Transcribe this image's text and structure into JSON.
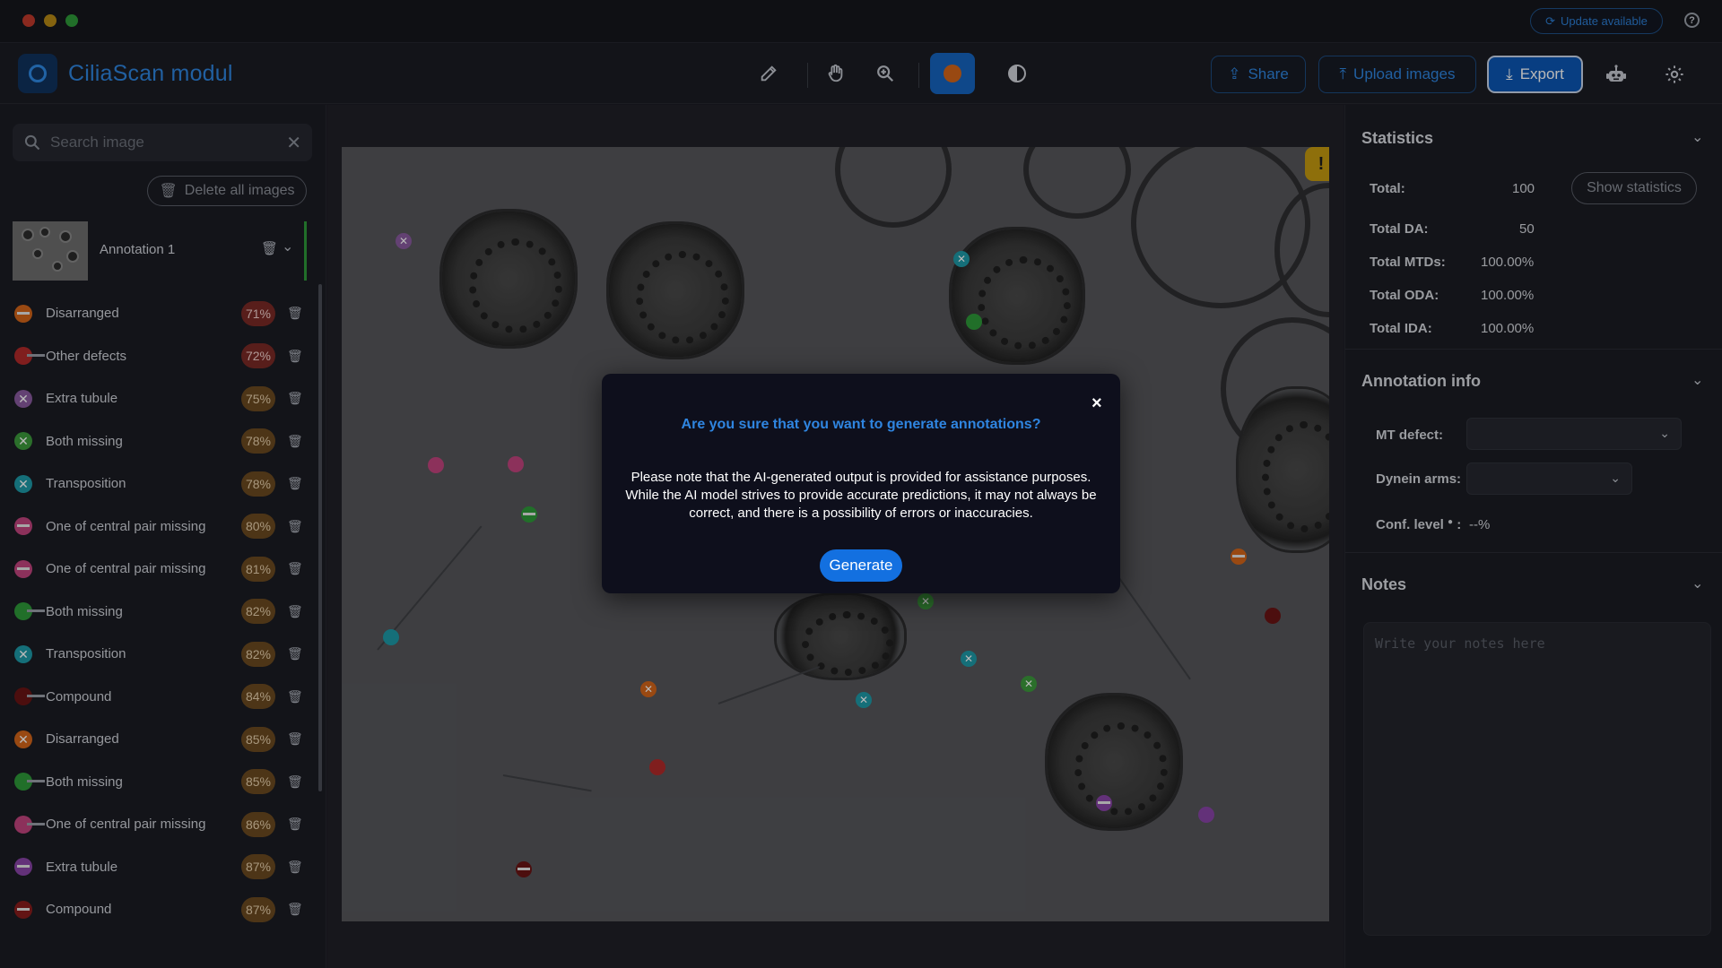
{
  "titlebar": {
    "update_label": "Update available",
    "help_icon": "question-circle-icon"
  },
  "header": {
    "app_title": "CiliaScan modul",
    "tools": [
      "edit-icon",
      "hand-icon",
      "zoom-in-icon",
      "marker-color-icon",
      "contrast-icon"
    ],
    "share_label": "Share",
    "upload_label": "Upload images",
    "export_label": "Export",
    "icons": [
      "robot-icon",
      "gear-icon"
    ]
  },
  "sidebar": {
    "search_placeholder": "Search image",
    "delete_all_label": "Delete all images",
    "annotation_name": "Annotation 1",
    "defects": [
      {
        "label": "Disarranged",
        "pct": "71%",
        "color": "#d5661a",
        "kind": "bar",
        "pct_style": "red"
      },
      {
        "label": "Other defects",
        "pct": "72%",
        "color": "#b22a2a",
        "kind": "tail",
        "pct_style": "red"
      },
      {
        "label": "Extra tubule",
        "pct": "75%",
        "color": "#8a5aa0",
        "kind": "x",
        "pct_style": "brown"
      },
      {
        "label": "Both missing",
        "pct": "78%",
        "color": "#3c9a3c",
        "kind": "x",
        "pct_style": "brown"
      },
      {
        "label": "Transposition",
        "pct": "78%",
        "color": "#1e9aa8",
        "kind": "x",
        "pct_style": "brown"
      },
      {
        "label": "One of central pair missing",
        "pct": "80%",
        "color": "#c2447e",
        "kind": "bar",
        "pct_style": "brown"
      },
      {
        "label": "One of central pair missing",
        "pct": "81%",
        "color": "#c2447e",
        "kind": "bar",
        "pct_style": "brown"
      },
      {
        "label": "Both missing",
        "pct": "82%",
        "color": "#2e9a3a",
        "kind": "tail",
        "pct_style": "brown"
      },
      {
        "label": "Transposition",
        "pct": "82%",
        "color": "#1e9aa8",
        "kind": "x",
        "pct_style": "brown"
      },
      {
        "label": "Compound",
        "pct": "84%",
        "color": "#6a1414",
        "kind": "tail",
        "pct_style": "brown"
      },
      {
        "label": "Disarranged",
        "pct": "85%",
        "color": "#d5661a",
        "kind": "x",
        "pct_style": "brown"
      },
      {
        "label": "Both missing",
        "pct": "85%",
        "color": "#2e9a3a",
        "kind": "tail",
        "pct_style": "brown"
      },
      {
        "label": "One of central pair missing",
        "pct": "86%",
        "color": "#c2447e",
        "kind": "tail",
        "pct_style": "brown"
      },
      {
        "label": "Extra tubule",
        "pct": "87%",
        "color": "#8a44a8",
        "kind": "bar",
        "pct_style": "brown"
      },
      {
        "label": "Compound",
        "pct": "87%",
        "color": "#8a1c1c",
        "kind": "bar",
        "pct_style": "brown"
      }
    ]
  },
  "statistics": {
    "title": "Statistics",
    "show_label": "Show statistics",
    "rows": [
      {
        "label": "Total:",
        "value": "100"
      },
      {
        "label": "Total DA:",
        "value": "50"
      },
      {
        "label": "Total MTDs:",
        "value": "100.00%"
      },
      {
        "label": "Total ODA:",
        "value": "100.00%"
      },
      {
        "label": "Total IDA:",
        "value": "100.00%"
      }
    ]
  },
  "annotation_info": {
    "title": "Annotation info",
    "mt_defect_label": "MT defect:",
    "mt_defect_value": "",
    "dynein_label": "Dynein arms:",
    "dynein_value": "",
    "conf_label": "Conf. level",
    "conf_value": "--%"
  },
  "notes": {
    "title": "Notes",
    "placeholder": "Write your notes here"
  },
  "canvas": {
    "warning_badge": "!"
  },
  "modal": {
    "title": "Are you sure that you want to generate annotations?",
    "body": "Please note that the AI-generated output is provided for assistance purposes. While the AI model strives to provide accurate predictions, it may not always be correct, and there is a possibility of errors or inaccuracies.",
    "button_label": "Generate",
    "close": "×"
  }
}
